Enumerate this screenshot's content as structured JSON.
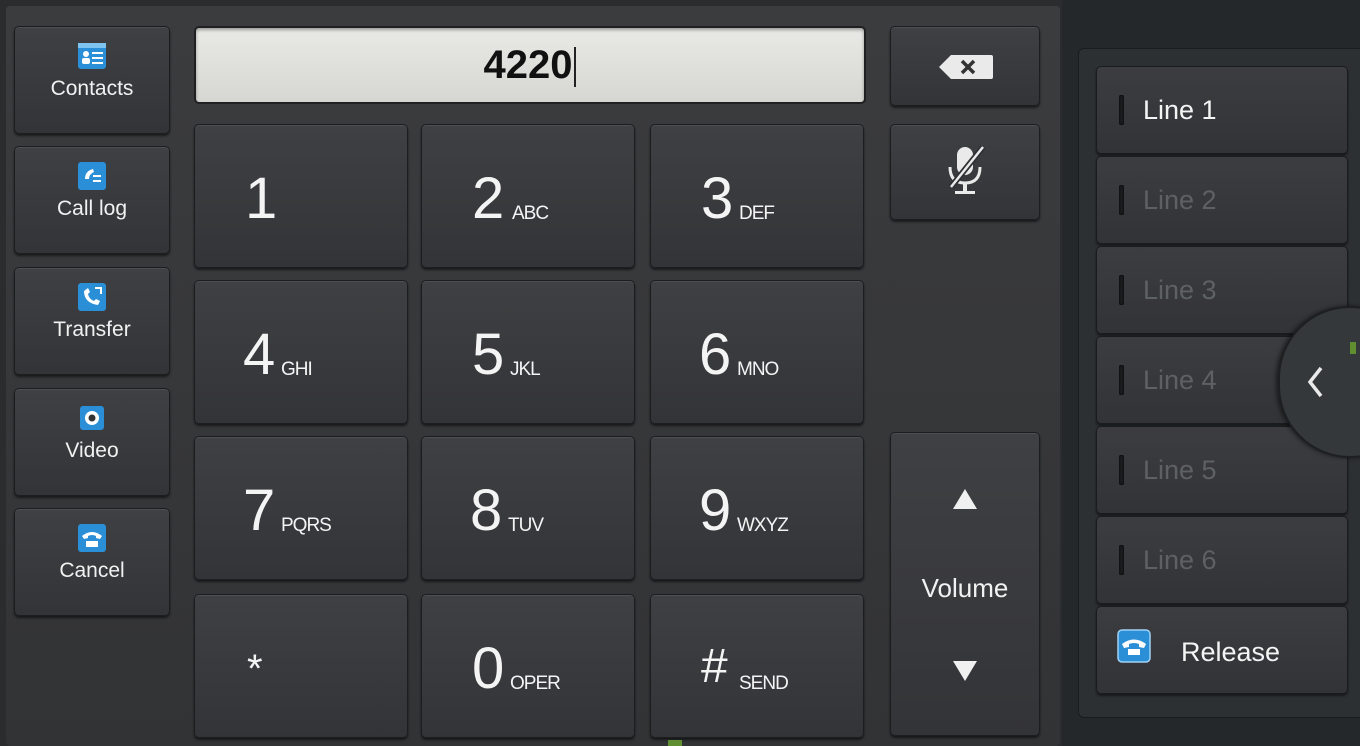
{
  "sidebar": {
    "items": [
      {
        "label": "Contacts",
        "icon": "contacts-icon"
      },
      {
        "label": "Call log",
        "icon": "call-log-icon"
      },
      {
        "label": "Transfer",
        "icon": "transfer-icon"
      },
      {
        "label": "Video",
        "icon": "video-icon"
      },
      {
        "label": "Cancel",
        "icon": "cancel-call-icon"
      }
    ]
  },
  "dialer": {
    "value": "4220",
    "keys": [
      {
        "digit": "1",
        "letters": ""
      },
      {
        "digit": "2",
        "letters": "ABC"
      },
      {
        "digit": "3",
        "letters": "DEF"
      },
      {
        "digit": "4",
        "letters": "GHI"
      },
      {
        "digit": "5",
        "letters": "JKL"
      },
      {
        "digit": "6",
        "letters": "MNO"
      },
      {
        "digit": "7",
        "letters": "PQRS"
      },
      {
        "digit": "8",
        "letters": "TUV"
      },
      {
        "digit": "9",
        "letters": "WXYZ"
      },
      {
        "digit": "*",
        "letters": ""
      },
      {
        "digit": "0",
        "letters": "OPER"
      },
      {
        "digit": "#",
        "letters": "SEND"
      }
    ]
  },
  "controls": {
    "backspace_icon": "backspace-icon",
    "mute_icon": "mute-microphone-icon",
    "volume_label": "Volume"
  },
  "lines": {
    "items": [
      {
        "label": "Line 1",
        "active": true
      },
      {
        "label": "Line 2",
        "active": false
      },
      {
        "label": "Line 3",
        "active": false
      },
      {
        "label": "Line 4",
        "active": false
      },
      {
        "label": "Line 5",
        "active": false
      },
      {
        "label": "Line 6",
        "active": false
      }
    ],
    "release_label": "Release"
  },
  "colors": {
    "panel": "#37383a",
    "icon_blue": "#1f8fd6",
    "inactive_text": "#5e6164"
  }
}
